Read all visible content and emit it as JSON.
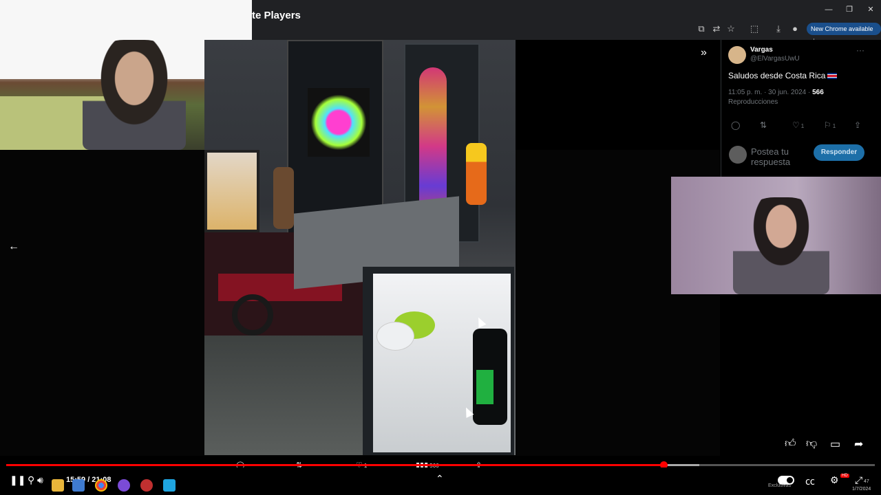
{
  "browser": {
    "title": "te Players",
    "new_chrome_label": "New Chrome available",
    "window_buttons": [
      "—",
      "❐",
      "✕"
    ],
    "toolbar_icons": [
      "screen-share-icon",
      "translate-icon",
      "star-icon",
      "extensions-icon",
      "download-icon",
      "profile-icon"
    ]
  },
  "tweet": {
    "author_name": "Vargas",
    "author_handle": "@ElVargasUwU",
    "text": "Saludos desde Costa Rica",
    "time": "11:05 p. m. · 30 jun. 2024 · ",
    "views": "566",
    "views_label": "Reproducciones",
    "likes": "1",
    "bookmarks": "1",
    "reply_placeholder": "Postea tu respuesta",
    "reply_button": "Responder"
  },
  "overlay_bar": {
    "likes": "1",
    "views": "566"
  },
  "player": {
    "time": "15:59 / 21:08",
    "progress_fraction": 0.757,
    "buffer_fraction": 0.798
  },
  "taskbar": {
    "tray_text": "Exclusivas",
    "badge": "HD",
    "clock_time": "47",
    "clock_date": "1/7/2024"
  }
}
